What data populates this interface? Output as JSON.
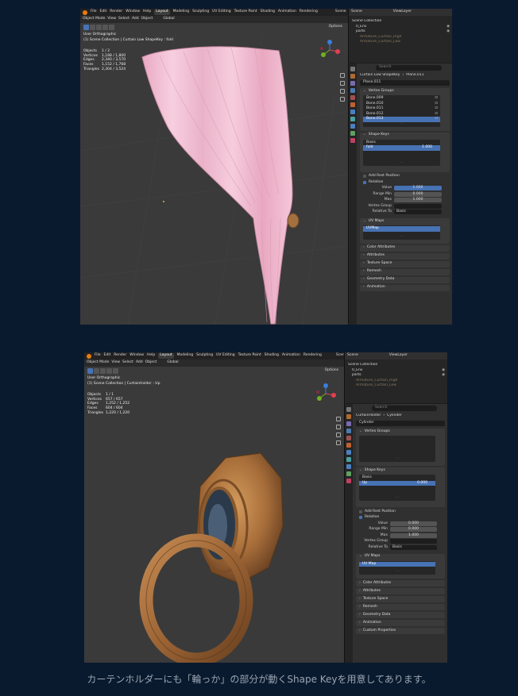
{
  "screenshot1": {
    "menu": [
      "File",
      "Edit",
      "Render",
      "Window",
      "Help"
    ],
    "workspaces": [
      "Layout",
      "Modeling",
      "Sculpting",
      "UV Editing",
      "Texture Paint",
      "Shading",
      "Animation",
      "Rendering"
    ],
    "active_workspace": "Layout",
    "scene": "Scene",
    "view_layer": "ViewLayer",
    "mode": "Object Mode",
    "view_menu": [
      "View",
      "Select",
      "Add",
      "Object"
    ],
    "orientation": "Global",
    "options_label": "Options",
    "viewport_title": "User Orthographic",
    "viewport_sub": "(1) Scene Collection | Curtain Low ShapeKey : fold",
    "stats": [
      {
        "k": "Objects",
        "v": "1 / 2"
      },
      {
        "k": "Vertices",
        "v": "1,188 / 1,800"
      },
      {
        "k": "Edges",
        "v": "2,340 / 3,570"
      },
      {
        "k": "Faces",
        "v": "1,152 / 1,768"
      },
      {
        "k": "Triangles",
        "v": "2,304 / 3,524"
      }
    ],
    "outliner": [
      {
        "label": "Scene Collection",
        "style": "normal",
        "indent": 0
      },
      {
        "label": "0_Env",
        "style": "normal",
        "indent": 1
      },
      {
        "label": "parts",
        "style": "normal",
        "indent": 1
      },
      {
        "label": "Armature_Curtain_High",
        "style": "dim",
        "indent": 2
      },
      {
        "label": "Armature_Curtain_Low",
        "style": "dim",
        "indent": 2
      }
    ],
    "search_placeholder": "Search",
    "breadcrumb_obj": "Curtain Low ShapeKey",
    "breadcrumb_mesh": "Plane.011",
    "mesh_name": "Plane.011",
    "vertex_groups_title": "Vertex Groups",
    "vertex_groups": [
      "Bone.009",
      "Bone.010",
      "Bone.011",
      "Bone.012",
      "Bone.013"
    ],
    "vertex_group_selected": 4,
    "shape_keys_title": "Shape Keys",
    "shape_keys": [
      {
        "name": "Basis",
        "value": ""
      },
      {
        "name": "fold",
        "value": "1.000"
      }
    ],
    "shape_key_selected": 1,
    "add_rest": "Add Rest Position",
    "relative": "Relative",
    "value_label": "Value",
    "value": "1.000",
    "range_min_label": "Range Min",
    "range_min": "0.000",
    "max_label": "Max",
    "max": "1.000",
    "vgroup_label": "Vertex Group",
    "relative_to_label": "Relative To",
    "relative_to": "Basis",
    "uv_maps_title": "UV Maps",
    "uv_maps": [
      "UVMap"
    ],
    "collapsed_panels": [
      "Color Attributes",
      "Attributes",
      "Texture Space",
      "Remesh",
      "Geometry Data",
      "Animation"
    ]
  },
  "screenshot2": {
    "menu": [
      "File",
      "Edit",
      "Render",
      "Window",
      "Help"
    ],
    "workspaces": [
      "Layout",
      "Modeling",
      "Sculpting",
      "UV Editing",
      "Texture Paint",
      "Shading",
      "Animation",
      "Rendering"
    ],
    "active_workspace": "Layout",
    "scene": "Scene",
    "view_layer": "ViewLayer",
    "mode": "Object Mode",
    "view_menu": [
      "View",
      "Select",
      "Add",
      "Object"
    ],
    "orientation": "Global",
    "options_label": "Options",
    "viewport_title": "User Orthographic",
    "viewport_sub": "(1) Scene Collection | CurtainHolder : Up",
    "stats": [
      {
        "k": "Objects",
        "v": "1 / 1"
      },
      {
        "k": "Vertices",
        "v": "657 / 657"
      },
      {
        "k": "Edges",
        "v": "1,252 / 1,252"
      },
      {
        "k": "Faces",
        "v": "604 / 604"
      },
      {
        "k": "Triangles",
        "v": "1,220 / 1,220"
      }
    ],
    "outliner": [
      {
        "label": "Scene Collection",
        "style": "normal",
        "indent": 0
      },
      {
        "label": "0_Env",
        "style": "normal",
        "indent": 1
      },
      {
        "label": "parts",
        "style": "normal",
        "indent": 1
      },
      {
        "label": "Armature_Curtain_High",
        "style": "dim",
        "indent": 2
      },
      {
        "label": "Armature_Curtain_Low",
        "style": "dim",
        "indent": 2
      }
    ],
    "search_placeholder": "Search",
    "breadcrumb_obj": "CurtainHolder",
    "breadcrumb_mesh": "Cylinder",
    "mesh_name": "Cylinder",
    "vertex_groups_title": "Vertex Groups",
    "vertex_groups": [],
    "vertex_group_selected": -1,
    "shape_keys_title": "Shape Keys",
    "shape_keys": [
      {
        "name": "Basis",
        "value": ""
      },
      {
        "name": "Up",
        "value": "0.000"
      }
    ],
    "shape_key_selected": 1,
    "add_rest": "Add Rest Position",
    "relative": "Relative",
    "value_label": "Value",
    "value": "0.000",
    "range_min_label": "Range Min",
    "range_min": "0.000",
    "max_label": "Max",
    "max": "1.000",
    "vgroup_label": "Vertex Group",
    "relative_to_label": "Relative To",
    "relative_to": "Basis",
    "uv_maps_title": "UV Maps",
    "uv_maps": [
      "UV Map"
    ],
    "collapsed_panels": [
      "Color Attributes",
      "Attributes",
      "Texture Space",
      "Remesh",
      "Geometry Data",
      "Animation",
      "Custom Properties"
    ]
  },
  "caption": "カーテンホルダーにも「輪っか」の部分が動くShape Keyを用意してあります。",
  "colors": {
    "page_bg": "#0a1a2e",
    "accent": "#4772b3",
    "curtain": "#f2bfd2",
    "brass": "#b07a45"
  }
}
